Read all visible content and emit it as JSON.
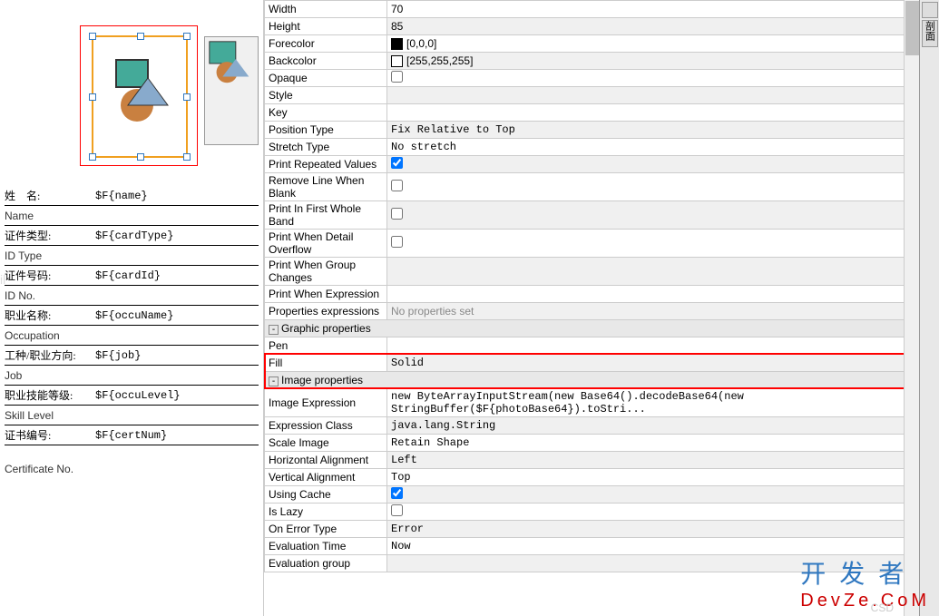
{
  "form": {
    "name_label": "姓　名:",
    "name_val": "$F{name}",
    "name_en": "Name",
    "cardtype_label": "证件类型:",
    "cardtype_val": "$F{cardType}",
    "cardtype_en": "ID Type",
    "cardid_label": "证件号码:",
    "cardid_val": "$F{cardId}",
    "cardid_en": "ID No.",
    "occuname_label": "职业名称:",
    "occuname_val": "$F{occuName}",
    "occuname_en": "Occupation",
    "job_label": "工种/职业方向:",
    "job_val": "$F{job}",
    "job_en": "Job",
    "occulevel_label": "职业技能等级:",
    "occulevel_val": "$F{occuLevel}",
    "occulevel_en": "Skill Level",
    "certnum_label": "证书编号:",
    "certnum_val": "$F{certNum}",
    "certnum_en": "Certificate No."
  },
  "props": {
    "width": {
      "label": "Width",
      "val": "70"
    },
    "height": {
      "label": "Height",
      "val": "85"
    },
    "forecolor": {
      "label": "Forecolor",
      "val": "[0,0,0]",
      "swatch": "#000000"
    },
    "backcolor": {
      "label": "Backcolor",
      "val": "[255,255,255]",
      "swatch": "#ffffff"
    },
    "opaque": {
      "label": "Opaque",
      "checked": false
    },
    "style": {
      "label": "Style",
      "val": ""
    },
    "key": {
      "label": "Key",
      "val": ""
    },
    "postype": {
      "label": "Position Type",
      "val": "Fix Relative to Top"
    },
    "stretchtype": {
      "label": "Stretch Type",
      "val": "No stretch"
    },
    "printrepeat": {
      "label": "Print Repeated Values",
      "checked": true
    },
    "removeblank": {
      "label": "Remove Line When Blank",
      "checked": false
    },
    "printfirst": {
      "label": "Print In First Whole Band",
      "checked": false
    },
    "printoverflow": {
      "label": "Print When Detail Overflow",
      "checked": false
    },
    "printgroup": {
      "label": "Print When Group Changes",
      "val": ""
    },
    "printexpr": {
      "label": "Print When Expression",
      "val": ""
    },
    "propsexpr": {
      "label": "Properties expressions",
      "val": "No properties set"
    },
    "graphic_hdr": "Graphic properties",
    "pen": {
      "label": "Pen",
      "val": ""
    },
    "fill": {
      "label": "Fill",
      "val": "Solid"
    },
    "image_hdr": "Image properties",
    "imgexpr": {
      "label": "Image Expression",
      "val": "new ByteArrayInputStream(new Base64().decodeBase64(new StringBuffer($F{photoBase64}).toStri..."
    },
    "exprclass": {
      "label": "Expression Class",
      "val": "java.lang.String"
    },
    "scaleimg": {
      "label": "Scale Image",
      "val": "Retain Shape"
    },
    "halign": {
      "label": "Horizontal Alignment",
      "val": "Left"
    },
    "valign": {
      "label": "Vertical Alignment",
      "val": "Top"
    },
    "cache": {
      "label": "Using Cache",
      "checked": true
    },
    "lazy": {
      "label": "Is Lazy",
      "checked": false
    },
    "onerror": {
      "label": "On Error Type",
      "val": "Error"
    },
    "evaltime": {
      "label": "Evaluation Time",
      "val": "Now"
    },
    "evalgroup": {
      "label": "Evaluation group",
      "val": ""
    }
  },
  "watermark": {
    "cn": "开 发 者",
    "en": "DevZe.CoM"
  },
  "csdn": "CSD",
  "side_label": "剖面"
}
